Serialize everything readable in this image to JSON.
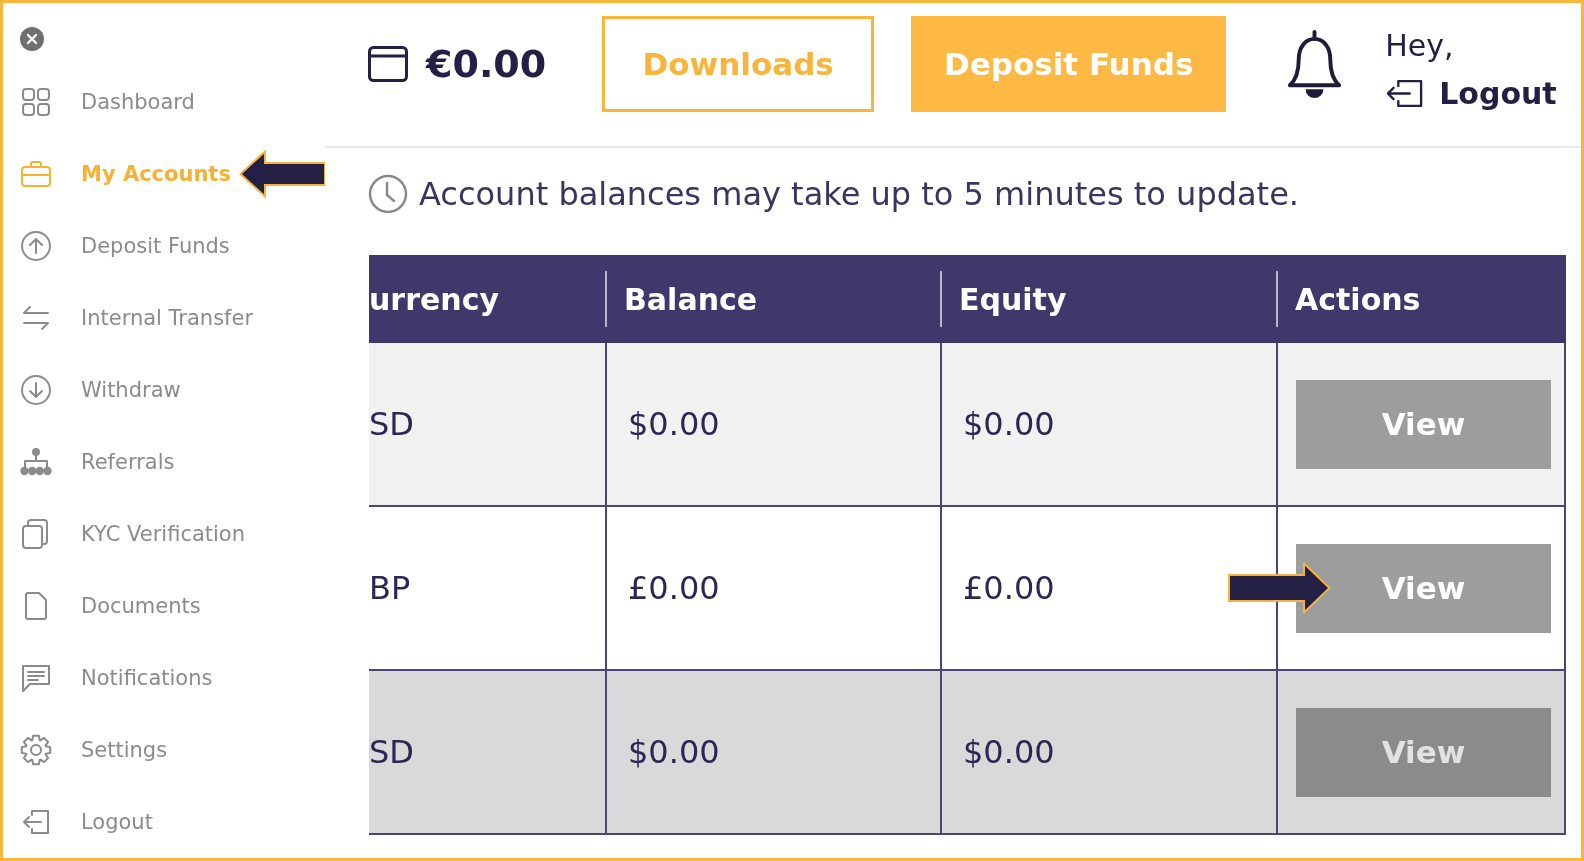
{
  "sidebar": {
    "items": [
      {
        "label": "Dashboard",
        "selected": false,
        "marked_by_arrow": false
      },
      {
        "label": "My Accounts",
        "selected": true,
        "marked_by_arrow": true
      },
      {
        "label": "Deposit Funds",
        "selected": false,
        "marked_by_arrow": false
      },
      {
        "label": "Internal Transfer",
        "selected": false,
        "marked_by_arrow": false
      },
      {
        "label": "Withdraw",
        "selected": false,
        "marked_by_arrow": false
      },
      {
        "label": "Referrals",
        "selected": false,
        "marked_by_arrow": false
      },
      {
        "label": "KYC Verification",
        "selected": false,
        "marked_by_arrow": false
      },
      {
        "label": "Documents",
        "selected": false,
        "marked_by_arrow": false
      },
      {
        "label": "Notifications",
        "selected": false,
        "marked_by_arrow": false
      },
      {
        "label": "Settings",
        "selected": false,
        "marked_by_arrow": false
      },
      {
        "label": "Logout",
        "selected": false,
        "marked_by_arrow": false
      }
    ]
  },
  "header": {
    "balance": "€0.00",
    "buttons": [
      {
        "label": "Downloads",
        "kind": "outline"
      },
      {
        "label": "Deposit Funds",
        "kind": "filled"
      }
    ],
    "greeting": "Hey,",
    "logout": "Logout"
  },
  "notice": "Account balances may take up to 5 minutes to update.",
  "table": {
    "columns": [
      "urrency",
      "Balance",
      "Equity",
      "Actions"
    ],
    "rows": [
      {
        "cells": [
          "SD",
          "$0.00",
          "$0.00"
        ],
        "action": "View",
        "hovered": false,
        "marked_by_arrow": false
      },
      {
        "cells": [
          "BP",
          "£0.00",
          "£0.00"
        ],
        "action": "View",
        "hovered": false,
        "marked_by_arrow": true
      },
      {
        "cells": [
          "SD",
          "$0.00",
          "$0.00"
        ],
        "action": "View",
        "hovered": true,
        "marked_by_arrow": false
      }
    ]
  }
}
